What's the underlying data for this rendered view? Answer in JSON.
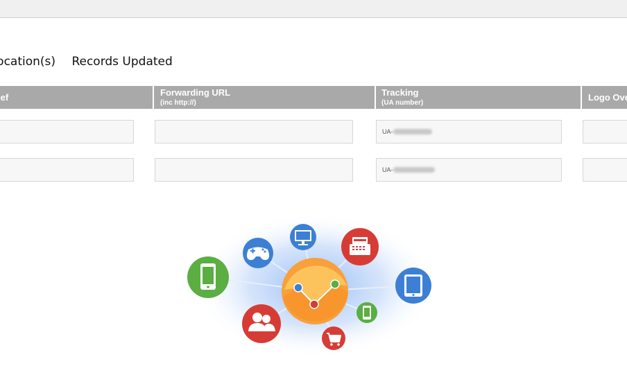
{
  "heading": {
    "locations": "Location(s)",
    "status": "Records Updated"
  },
  "table": {
    "columns": [
      {
        "label": "V Ref",
        "sub": ""
      },
      {
        "label": "Forwarding URL",
        "sub": "(inc http://)"
      },
      {
        "label": "Tracking",
        "sub": "(UA number)"
      },
      {
        "label": "Logo Override",
        "sub": ""
      }
    ],
    "rows": [
      {
        "ref": "",
        "url": "",
        "tracking": "UA-",
        "logo": ""
      },
      {
        "ref": "",
        "url": "",
        "tracking": "UA-",
        "logo": ""
      }
    ]
  },
  "colors": {
    "header_bg": "#a9a9a9",
    "center": "#f9a03a",
    "green": "#5aae42",
    "blue": "#3d7fd4",
    "red": "#d63c35"
  },
  "graphic": {
    "icons": [
      "gamepad-icon",
      "monitor-icon",
      "cash-register-icon",
      "smartphone-icon",
      "tablet-icon",
      "users-icon",
      "small-phone-icon",
      "shopping-cart-icon",
      "analytics-chart-icon"
    ]
  }
}
